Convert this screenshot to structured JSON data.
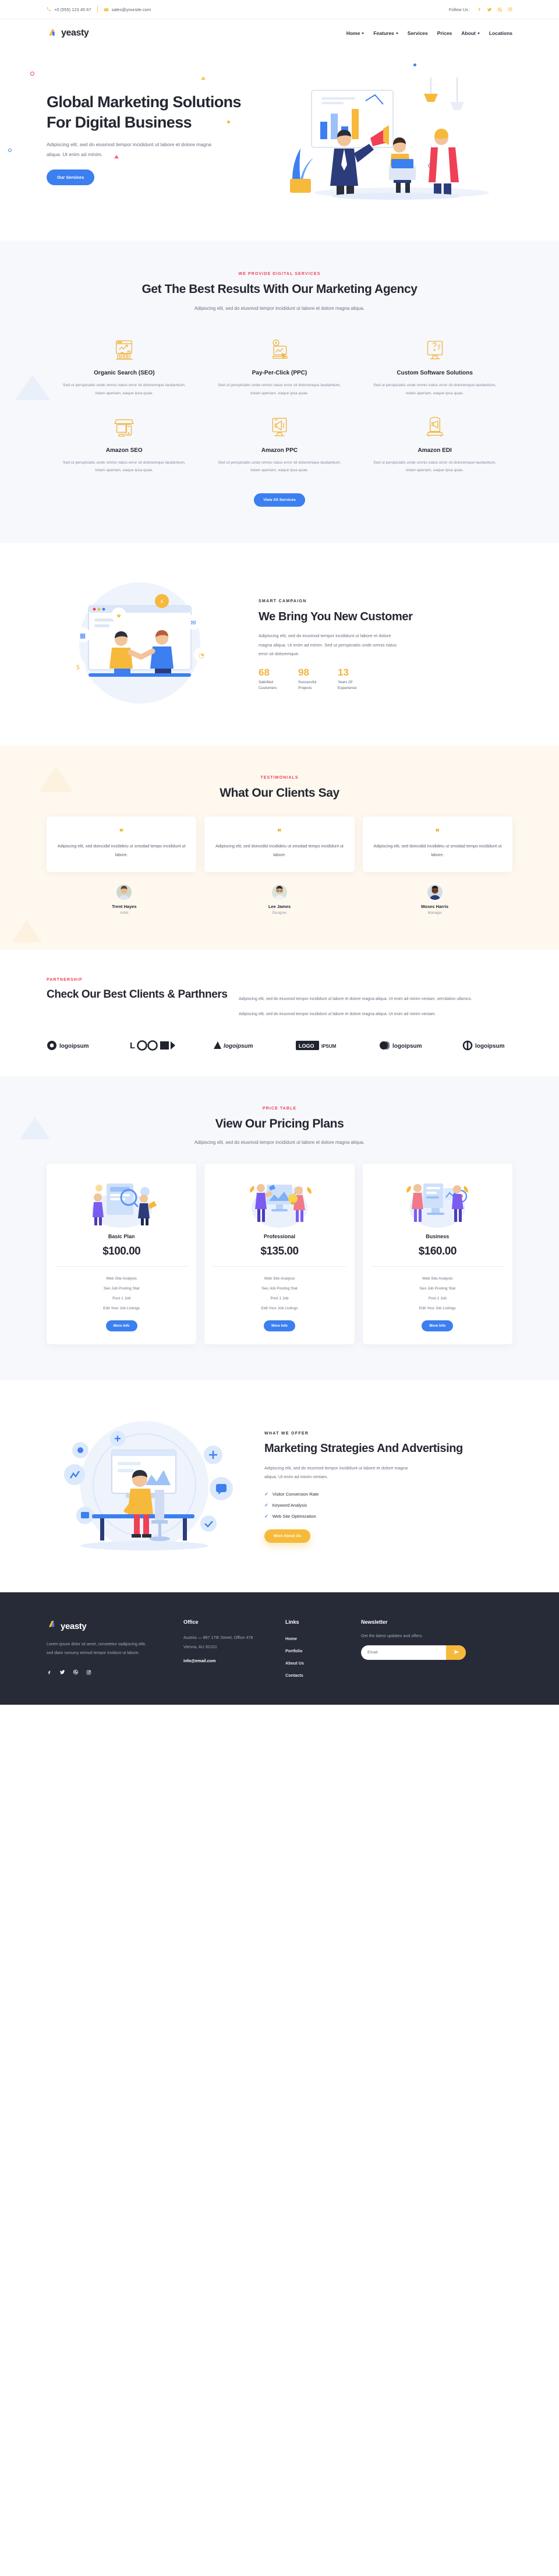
{
  "topbar": {
    "phone": "+0 (555) 123 45 67",
    "email": "sales@yoursite.com",
    "follow_label": "Follow Us :",
    "socials": [
      "facebook-icon",
      "twitter-icon",
      "dribbble-icon",
      "instagram-icon"
    ]
  },
  "brand": {
    "name": "yeasty",
    "accent_blue": "#3c7ff0",
    "accent_amber": "#f6b93b",
    "accent_red": "#ef4056"
  },
  "nav": {
    "items": [
      {
        "label": "Home",
        "has_dropdown": true
      },
      {
        "label": "Features",
        "has_dropdown": true
      },
      {
        "label": "Services",
        "has_dropdown": false
      },
      {
        "label": "Prices",
        "has_dropdown": false
      },
      {
        "label": "About",
        "has_dropdown": true
      },
      {
        "label": "Locations",
        "has_dropdown": false
      }
    ]
  },
  "hero": {
    "title": "Global Marketing Solutions For Digital Business",
    "desc": "Adipiscing elit, sed do eiusmod tempor incididunt ut labore et dolore magna aliqua. Ut enim ad minim.",
    "cta": "Our Services"
  },
  "services": {
    "eyebrow": "WE PROVIDE DIGITAL SERVICES",
    "title": "Get The Best Results With Our Marketing Agency",
    "sub": "Adipiscing elit, sed do eiusmod tempor incididunt ut labore et dolore magna aliqua.",
    "body": "Sed ut perspiciatis unde omnis natus error sit doloremque laudantium, totam aperiam, eaque ipsa quae.",
    "items": [
      {
        "title": "Organic Search (SEO)",
        "icon": "seo-chart-icon"
      },
      {
        "title": "Pay-Per-Click (PPC)",
        "icon": "ppc-cursor-icon"
      },
      {
        "title": "Custom Software Solutions",
        "icon": "monitor-tools-icon"
      },
      {
        "title": "Amazon SEO",
        "icon": "store-mobile-icon"
      },
      {
        "title": "Amazon PPC",
        "icon": "monitor-megaphone-icon"
      },
      {
        "title": "Amazon EDI",
        "icon": "announce-icon"
      }
    ],
    "cta": "View All Services"
  },
  "campaign": {
    "eyebrow": "SMART CAMPAIGN",
    "title": "We Bring You New Customer",
    "desc": "Adipiscing elit, sed do eiusmod tempor incididunt ut labore et dolore magna aliqua. Ut enim ad minim. Sed ut perspiciatis unde omnis natus error sit doloremque.",
    "stats": [
      {
        "num": "68",
        "label": "Satisfied Customers"
      },
      {
        "num": "98",
        "label": "Successful Projects"
      },
      {
        "num": "13",
        "label": "Years Of Experience"
      }
    ]
  },
  "testimonials": {
    "eyebrow": "TESTIMONIALS",
    "title": "What Our Clients Say",
    "quote": "Adipiscing elit, sed doincidid incidideiu ut smodad tempo incididunt ut labore.",
    "people": [
      {
        "name": "Trent Hayes",
        "role": "Artist"
      },
      {
        "name": "Lee James",
        "role": "Designer"
      },
      {
        "name": "Moses Harris",
        "role": "Manager"
      }
    ]
  },
  "partners": {
    "eyebrow": "PARTNERSHIP",
    "title": "Check Our Best Clients & Parthners",
    "para1": "Adipiscing elit, sed do eiusmod tempor incididunt ut labore et dolore magna aliqua. Ut enim ad minim veniam, xercitation ullamco.",
    "para2": "Adipiscing elit, sed do eiusmod tempor incididunt ut labore et dolore magna aliqua. Ut enim ad minim veniam.",
    "logos": [
      "logoipsum",
      "LOGO",
      "logoipsum",
      "LOGO IPSUM",
      "logoipsum",
      "logoipsum"
    ]
  },
  "pricing": {
    "eyebrow": "PRICE TABLE",
    "title": "View Our Pricing Plans",
    "sub": "Adipiscing elit, sed do eiusmod tempor incididunt ut labore et dolore magna aliqua.",
    "plans": [
      {
        "name": "Basic Plan",
        "price": "$100.00",
        "features": [
          "Web Site Analysis",
          "Seo Job Posting Stat",
          "Post 1 Job",
          "Edit Your Job Listings"
        ],
        "cta": "More Info"
      },
      {
        "name": "Professional",
        "price": "$135.00",
        "features": [
          "Web Site Analysis",
          "Seo Job Posting Stat",
          "Post 1 Job",
          "Edit Your Job Listings"
        ],
        "cta": "More Info"
      },
      {
        "name": "Business",
        "price": "$160.00",
        "features": [
          "Web Site Analysis",
          "Seo Job Posting Stat",
          "Post 1 Job",
          "Edit Your Job Listings"
        ],
        "cta": "More Info"
      }
    ]
  },
  "offer": {
    "eyebrow": "WHAT WE OFFER",
    "title": "Marketing Strategies And Advertising",
    "desc": "Adipiscing elit, sed do eiusmod tempor incididunt ut labore et dolore magna aliqua. Ut enim ad minim veniam.",
    "checks": [
      "Visitor Conversion Rate",
      "Keyword Analysis",
      "Web Site Optimization"
    ],
    "cta": "More About Us"
  },
  "footer": {
    "desc": "Lorem ipsum dolor sit amet, consetetur sadipscing elitr, sed diam nonumy eirmod tempor invidunt ut labore.",
    "socials": [
      "facebook-icon",
      "twitter-icon",
      "dribbble-icon",
      "instagram-icon"
    ],
    "office": {
      "heading": "Office",
      "address": "Austria — 887 17th Street, Office 478 Vienna, AU 92101",
      "email": "info@email.com"
    },
    "links": {
      "heading": "Links",
      "items": [
        "Home",
        "Portfolio",
        "About Us",
        "Contacts"
      ]
    },
    "newsletter": {
      "heading": "Newsletter",
      "desc": "Get the latest updates and offers.",
      "placeholder": "Email",
      "button_icon": "send-icon"
    }
  }
}
